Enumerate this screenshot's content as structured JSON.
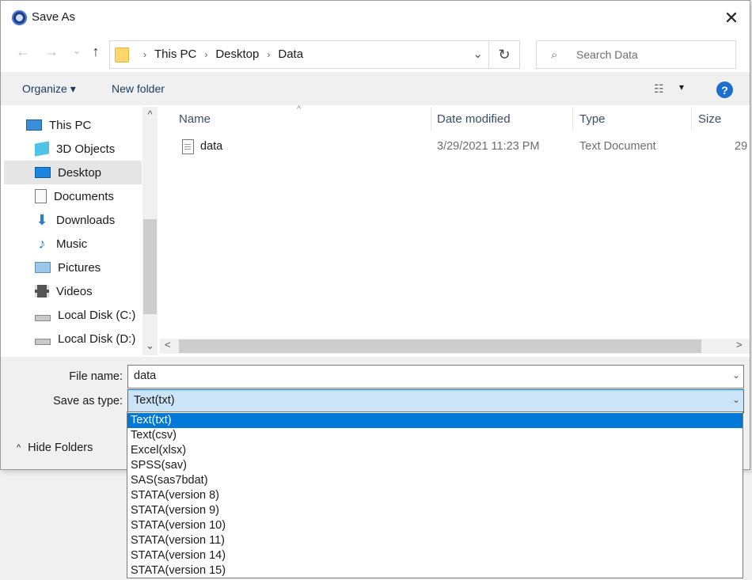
{
  "window": {
    "title": "Save As",
    "close": "✕"
  },
  "nav": {
    "back": "←",
    "forward": "→",
    "recent": "⌄",
    "up": "↑"
  },
  "address": {
    "crumbs": [
      "This PC",
      "Desktop",
      "Data"
    ],
    "separator": "›",
    "dropdown": "⌄",
    "refresh": "↻"
  },
  "search": {
    "placeholder": "Search Data",
    "icon": "search-icon"
  },
  "toolbar": {
    "organize": "Organize ▾",
    "new_folder": "New folder",
    "views_icon": "view-options-icon",
    "views_dd": "▾",
    "help": "?"
  },
  "sidebar": {
    "items": [
      {
        "label": "This PC",
        "icon": "pc-icon"
      },
      {
        "label": "3D Objects",
        "icon": "3d-objects-icon"
      },
      {
        "label": "Desktop",
        "icon": "desktop-icon"
      },
      {
        "label": "Documents",
        "icon": "documents-icon"
      },
      {
        "label": "Downloads",
        "icon": "downloads-icon"
      },
      {
        "label": "Music",
        "icon": "music-icon"
      },
      {
        "label": "Pictures",
        "icon": "pictures-icon"
      },
      {
        "label": "Videos",
        "icon": "videos-icon"
      },
      {
        "label": "Local Disk (C:)",
        "icon": "disk-icon"
      },
      {
        "label": "Local Disk (D:)",
        "icon": "disk-icon"
      }
    ],
    "selected": "Desktop",
    "scroll_up": "^",
    "scroll_down": "⌄"
  },
  "files": {
    "columns": [
      "Name",
      "Date modified",
      "Type",
      "Size"
    ],
    "sort_caret": "^",
    "rows": [
      {
        "name": "data",
        "date": "3/29/2021 11:23 PM",
        "type": "Text Document",
        "size": "29"
      }
    ]
  },
  "hscroll": {
    "left": "<",
    "right": ">"
  },
  "form": {
    "file_name_label": "File name:",
    "file_name_value": "data",
    "save_type_label": "Save as type:",
    "save_type_value": "Text(txt)",
    "dd": "⌄"
  },
  "hide_folders": {
    "caret": "^",
    "label": "Hide Folders"
  },
  "save_type_options": [
    "Text(txt)",
    "Text(csv)",
    "Excel(xlsx)",
    "SPSS(sav)",
    "SAS(sas7bdat)",
    "STATA(version 8)",
    "STATA(version 9)",
    "STATA(version 10)",
    "STATA(version 11)",
    "STATA(version 14)",
    "STATA(version 15)"
  ],
  "colors": {
    "accent": "#0078d7",
    "selected_bg": "#e5e5e5",
    "help": "#1a6fd0"
  }
}
